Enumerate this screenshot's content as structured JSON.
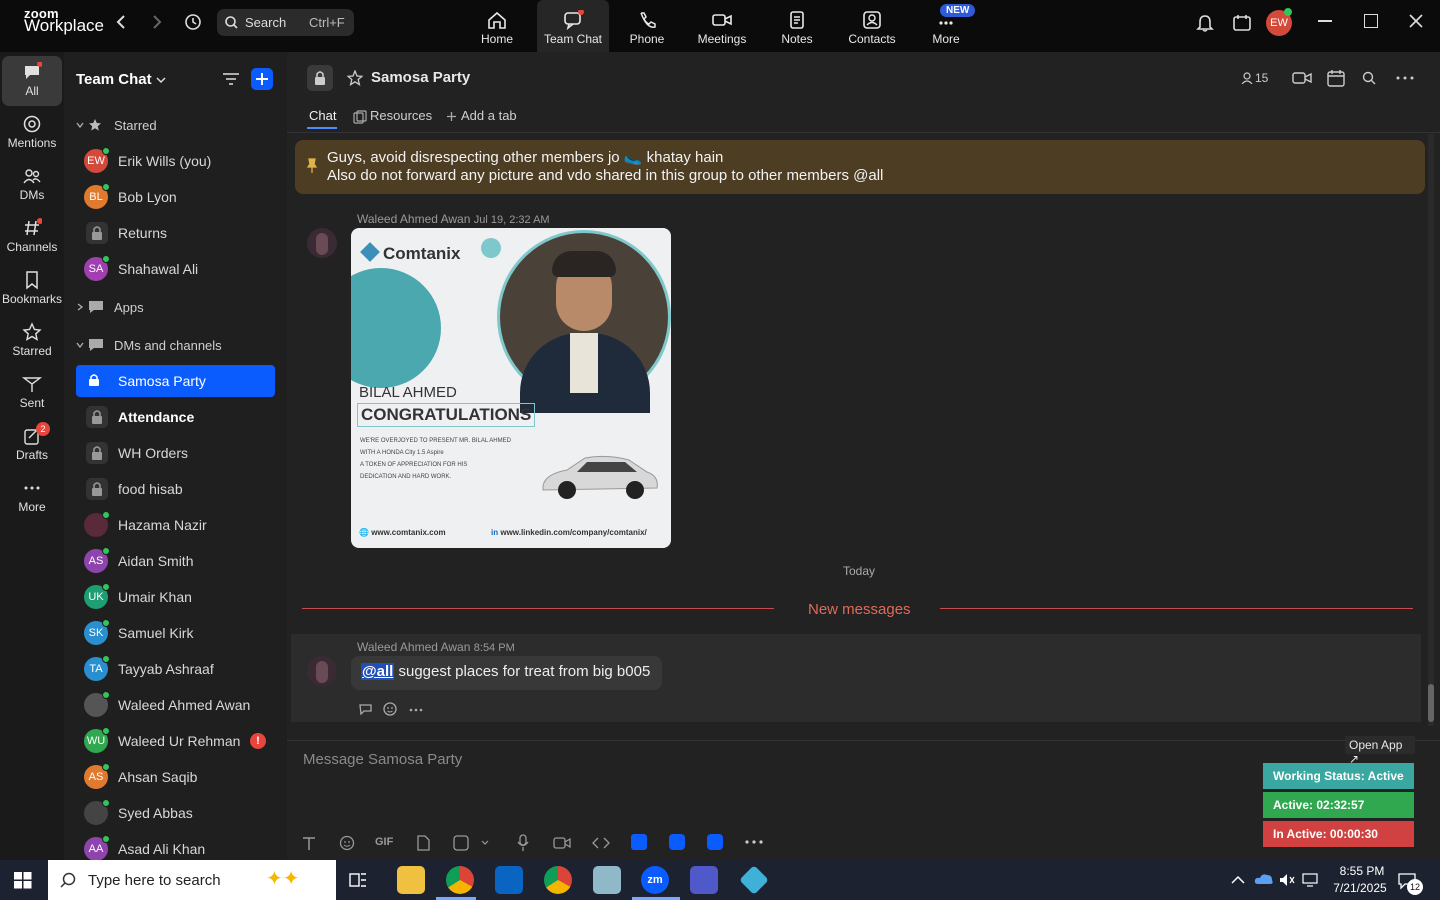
{
  "app": {
    "brand_top": "zoom",
    "brand_bottom": "Workplace"
  },
  "search": {
    "label": "Search",
    "shortcut": "Ctrl+F"
  },
  "topnav": [
    {
      "label": "Home",
      "icon": "home-icon"
    },
    {
      "label": "Team Chat",
      "icon": "chat-icon"
    },
    {
      "label": "Phone",
      "icon": "phone-icon"
    },
    {
      "label": "Meetings",
      "icon": "camera-icon"
    },
    {
      "label": "Notes",
      "icon": "notes-icon"
    },
    {
      "label": "Contacts",
      "icon": "contacts-icon"
    },
    {
      "label": "More",
      "icon": "more-icon",
      "badge": "NEW"
    }
  ],
  "user": {
    "initials": "EW"
  },
  "rail": [
    {
      "label": "All",
      "icon": "chat-bubble-icon"
    },
    {
      "label": "Mentions",
      "icon": "at-icon"
    },
    {
      "label": "DMs",
      "icon": "people-icon"
    },
    {
      "label": "Channels",
      "icon": "hash-icon"
    },
    {
      "label": "Bookmarks",
      "icon": "bookmark-icon"
    },
    {
      "label": "Starred",
      "icon": "star-icon"
    },
    {
      "label": "Sent",
      "icon": "sent-icon"
    },
    {
      "label": "Drafts",
      "icon": "drafts-icon",
      "badge": "2"
    },
    {
      "label": "More",
      "icon": "ellipsis-icon"
    }
  ],
  "sidebar": {
    "title": "Team Chat",
    "sections": {
      "starred": "Starred",
      "apps": "Apps",
      "dms": "DMs and channels"
    },
    "starred": [
      {
        "name": "Erik Wills (you)",
        "initials": "EW",
        "color": "#d34a3a",
        "online": true
      },
      {
        "name": "Bob Lyon",
        "initials": "BL",
        "color": "#e07a2e",
        "online": true
      },
      {
        "name": "Returns",
        "lock": true
      },
      {
        "name": "Shahawal Ali",
        "initials": "SA",
        "color": "#a040b0",
        "online": true
      }
    ],
    "dms": [
      {
        "name": "Samosa Party",
        "lock": true,
        "active": true
      },
      {
        "name": "Attendance",
        "lock": true,
        "bold": true
      },
      {
        "name": "WH Orders",
        "lock": true
      },
      {
        "name": "food hisab",
        "lock": true
      },
      {
        "name": "Hazama Nazir",
        "initials": "",
        "color": "#5a2a3a",
        "online": true
      },
      {
        "name": "Aidan Smith",
        "initials": "AS",
        "color": "#8e44ad",
        "online": true
      },
      {
        "name": "Umair Khan",
        "initials": "UK",
        "color": "#1e9e73",
        "online": true
      },
      {
        "name": "Samuel Kirk",
        "initials": "SK",
        "color": "#2a8fd0",
        "online": true
      },
      {
        "name": "Tayyab Ashraaf",
        "initials": "TA",
        "color": "#2a8fd0",
        "online": true
      },
      {
        "name": "Waleed Ahmed Awan",
        "initials": "",
        "color": "#555",
        "online": true
      },
      {
        "name": "Waleed Ur Rehman",
        "initials": "WU",
        "color": "#2fa84f",
        "online": true,
        "alert": "!"
      },
      {
        "name": "Ahsan Saqib",
        "initials": "AS",
        "color": "#e07a2e",
        "online": true
      },
      {
        "name": "Syed Abbas",
        "initials": "",
        "color": "#444",
        "online": true
      },
      {
        "name": "Asad Ali Khan",
        "initials": "AA",
        "color": "#8e44ad",
        "online": true
      }
    ]
  },
  "channel": {
    "name": "Samosa Party",
    "members": "15",
    "tabs": [
      "Chat",
      "Resources",
      "Add a tab"
    ]
  },
  "pinned": {
    "line1": "Guys, avoid disrespecting other members jo 🥿 khatay hain",
    "line2": "Also do not forward any picture and vdo shared in this group to other members @all"
  },
  "messages": [
    {
      "author": "Waleed Ahmed Awan",
      "time": "Jul 19, 2:32 AM"
    },
    {
      "author": "Waleed Ahmed Awan",
      "time": "8:54 PM",
      "mention": "@all",
      "text": " suggest places for treat from big b005"
    }
  ],
  "poster": {
    "brand": "Comtanix",
    "name": "BILAL AHMED",
    "headline": "CONGRATULATIONS",
    "body1": "WE'RE OVERJOYED TO PRESENT MR. BILAL AHMED",
    "body2": "WITH A HONDA City 1.5 Aspire",
    "body3": "A TOKEN OF APPRECIATION FOR HIS",
    "body4": "DEDICATION AND HARD WORK.",
    "web": "www.comtanix.com",
    "linkedin": "www.linkedin.com/company/comtanix/"
  },
  "divider": {
    "today": "Today",
    "new": "New messages"
  },
  "composer": {
    "placeholder": "Message Samosa Party"
  },
  "widget": {
    "open_app": "Open App ↗",
    "working": "Working Status: Active",
    "active": "Active: 02:32:57",
    "inactive": "In Active: 00:00:30"
  },
  "taskbar": {
    "search": "Type here to search",
    "time": "8:55 PM",
    "date": "7/21/2025",
    "notif": "12"
  },
  "colors": {
    "accent": "#0b5cff",
    "pinned_bg": "#4d3d22",
    "active_green": "#2fa84f",
    "inactive_red": "#d14141"
  }
}
